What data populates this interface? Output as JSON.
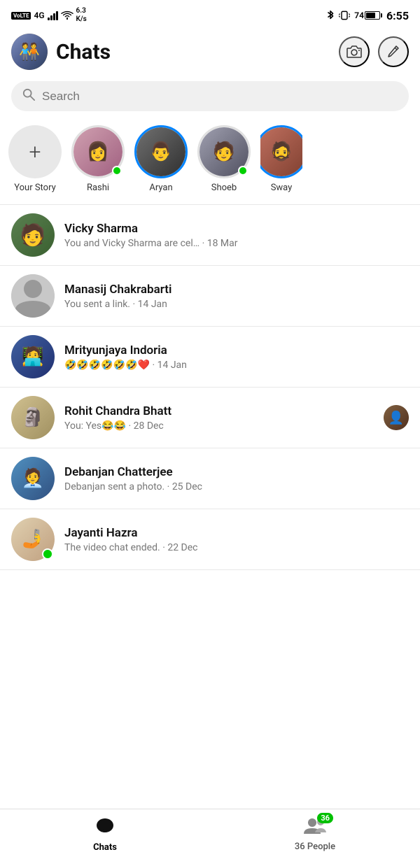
{
  "statusBar": {
    "leftText": "VoLTE",
    "network": "4G",
    "speed": "6.3 K/s",
    "time": "6:55",
    "battery": 74
  },
  "header": {
    "title": "Chats",
    "cameraLabel": "camera",
    "editLabel": "edit"
  },
  "search": {
    "placeholder": "Search"
  },
  "stories": [
    {
      "id": "your-story",
      "label": "Your Story",
      "isAdd": true
    },
    {
      "id": "rashi",
      "label": "Rashi",
      "hasOnline": true
    },
    {
      "id": "aryan",
      "label": "Aryan",
      "hasActive": true
    },
    {
      "id": "shoeb",
      "label": "Shoeb",
      "hasOnline": true
    },
    {
      "id": "sway",
      "label": "Sway",
      "partial": true
    }
  ],
  "chats": [
    {
      "id": "vicky",
      "name": "Vicky Sharma",
      "preview": "You and Vicky Sharma are cel…",
      "time": "18 Mar",
      "hasThumb": false,
      "hasOnline": false,
      "emoji": ""
    },
    {
      "id": "manasij",
      "name": "Manasij Chakrabarti",
      "preview": "You sent a link.",
      "time": "14 Jan",
      "hasThumb": false,
      "hasOnline": false,
      "emoji": ""
    },
    {
      "id": "mrityunjaya",
      "name": "Mrityunjaya Indoria",
      "preview": "🤣🤣🤣🤣🤣🤣❤️ · 14 Jan",
      "time": "",
      "hasThumb": false,
      "hasOnline": false,
      "emoji": "🤣🤣🤣🤣🤣🤣❤️"
    },
    {
      "id": "rohit",
      "name": "Rohit Chandra Bhatt",
      "preview": "You: Yes😂😂 · 28 Dec",
      "time": "",
      "hasThumb": true,
      "hasOnline": false,
      "emoji": ""
    },
    {
      "id": "debanjan",
      "name": "Debanjan Chatterjee",
      "preview": "Debanjan sent a photo.",
      "time": "25 Dec",
      "hasThumb": false,
      "hasOnline": false,
      "emoji": ""
    },
    {
      "id": "jayanti",
      "name": "Jayanti Hazra",
      "preview": "The video chat ended.",
      "time": "22 Dec",
      "hasThumb": false,
      "hasOnline": true,
      "emoji": ""
    }
  ],
  "bottomNav": {
    "chats": "Chats",
    "people": "36 People",
    "peopleCount": "36"
  }
}
